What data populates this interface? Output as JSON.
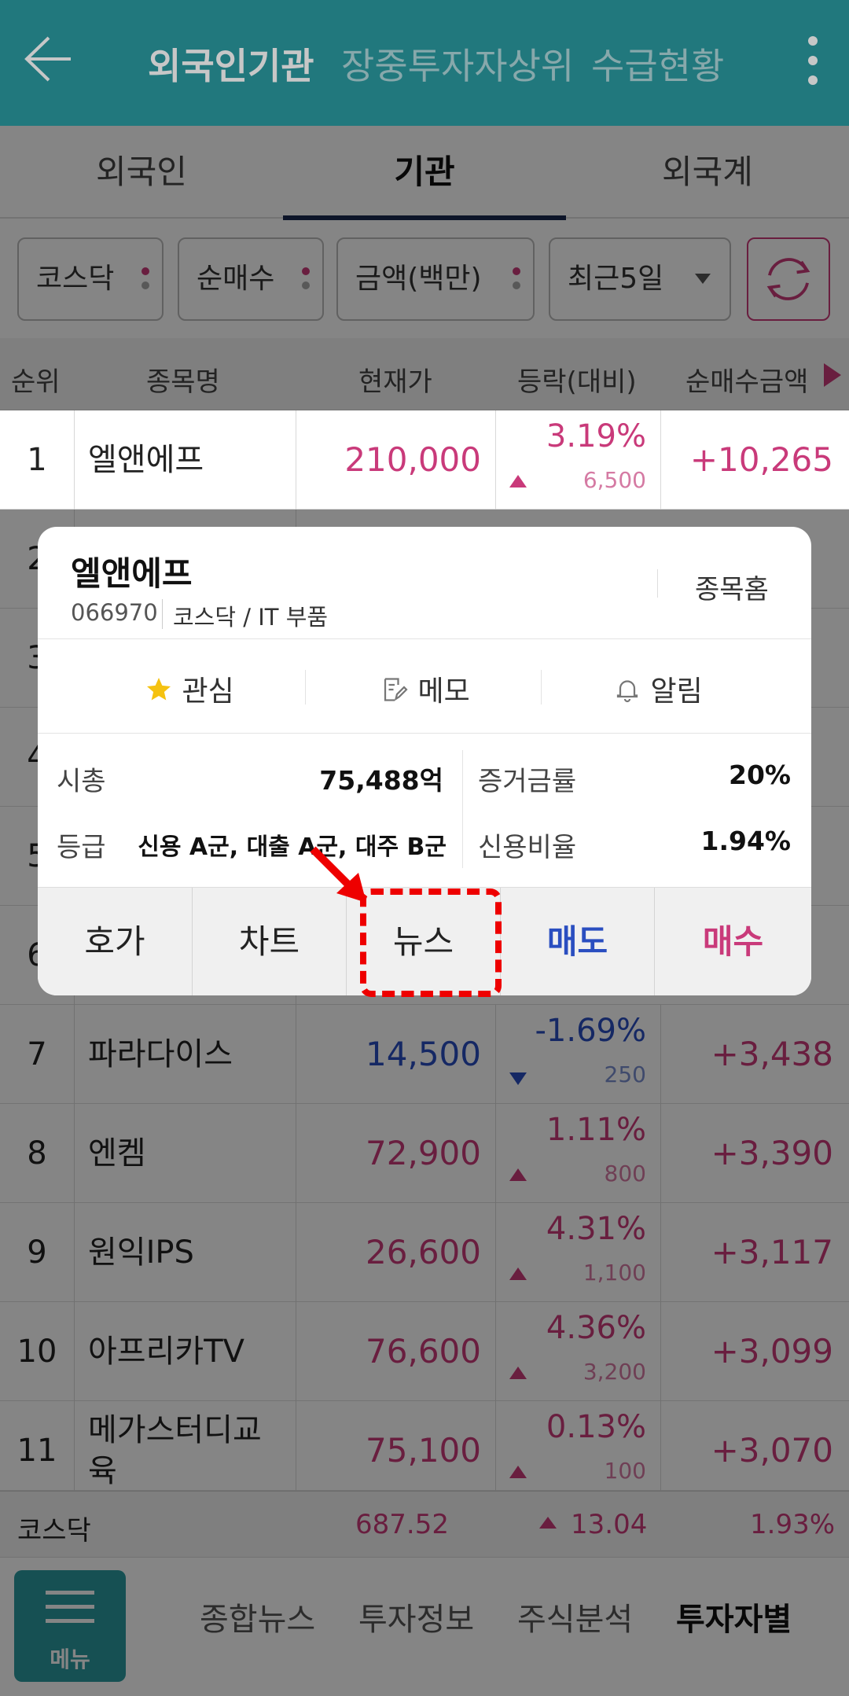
{
  "header": {
    "tabs": [
      {
        "label": "외국인기관",
        "active": true
      },
      {
        "label": "장중투자자상위",
        "active": false
      },
      {
        "label": "수급현황",
        "active": false
      }
    ],
    "accent": "#2b9aa0"
  },
  "investor_tabs": [
    {
      "label": "외국인",
      "active": false
    },
    {
      "label": "기관",
      "active": true
    },
    {
      "label": "외국계",
      "active": false
    }
  ],
  "filters": {
    "market": "코스닥",
    "type": "순매수",
    "unit": "금액(백만)",
    "period": "최근5일"
  },
  "columns": {
    "rank": "순위",
    "name": "종목명",
    "price": "현재가",
    "change": "등락(대비)",
    "net": "순매수금액"
  },
  "rows": [
    {
      "rank": "1",
      "name": "엘앤에프",
      "price": "210,000",
      "change": "3.19%",
      "diff": "6,500",
      "dir": "up",
      "net": "+10,265"
    },
    {
      "rank": "2",
      "name": "",
      "price": "",
      "change": "",
      "diff": "",
      "dir": "up",
      "net": ""
    },
    {
      "rank": "3",
      "name": "",
      "price": "",
      "change": "",
      "diff": "",
      "dir": "up",
      "net": ""
    },
    {
      "rank": "4",
      "name": "",
      "price": "",
      "change": "",
      "diff": "",
      "dir": "up",
      "net": ""
    },
    {
      "rank": "5",
      "name": "",
      "price": "",
      "change": "",
      "diff": "",
      "dir": "up",
      "net": ""
    },
    {
      "rank": "6",
      "name": "",
      "price": "",
      "change": "",
      "diff": "",
      "dir": "up",
      "net": ""
    },
    {
      "rank": "7",
      "name": "파라다이스",
      "price": "14,500",
      "change": "-1.69%",
      "diff": "250",
      "dir": "down",
      "net": "+3,438"
    },
    {
      "rank": "8",
      "name": "엔켐",
      "price": "72,900",
      "change": "1.11%",
      "diff": "800",
      "dir": "up",
      "net": "+3,390"
    },
    {
      "rank": "9",
      "name": "원익IPS",
      "price": "26,600",
      "change": "4.31%",
      "diff": "1,100",
      "dir": "up",
      "net": "+3,117"
    },
    {
      "rank": "10",
      "name": "아프리카TV",
      "price": "76,600",
      "change": "4.36%",
      "diff": "3,200",
      "dir": "up",
      "net": "+3,099"
    },
    {
      "rank": "11",
      "name": "메가스터디교육",
      "price": "75,100",
      "change": "0.13%",
      "diff": "100",
      "dir": "up",
      "net": "+3,070"
    }
  ],
  "index_bar": {
    "name": "코스닥",
    "value": "687.52",
    "change": "13.04",
    "rate": "1.93%"
  },
  "bottom_nav": {
    "menu_label": "메뉴",
    "items": [
      {
        "label": "종합뉴스",
        "active": false
      },
      {
        "label": "투자정보",
        "active": false
      },
      {
        "label": "주식분석",
        "active": false
      },
      {
        "label": "투자자별",
        "active": true
      }
    ]
  },
  "popup": {
    "name": "엘앤에프",
    "code": "066970",
    "market": "코스닥 / IT 부품",
    "home_label": "종목홈",
    "actions": {
      "favorite": "관심",
      "memo": "메모",
      "alert": "알림"
    },
    "info": {
      "mcap_label": "시총",
      "mcap_value": "75,488억",
      "margin_label": "증거금률",
      "margin_value": "20%",
      "grade_label": "등급",
      "grade_value": "신용 A군, 대출 A군, 대주 B군",
      "credit_label": "신용비율",
      "credit_value": "1.94%"
    },
    "buttons": {
      "quote": "호가",
      "chart": "차트",
      "news": "뉴스",
      "sell": "매도",
      "buy": "매수"
    }
  },
  "colors": {
    "up": "#c93a7a",
    "down": "#2a4ec0",
    "highlight": "#ee0000"
  }
}
